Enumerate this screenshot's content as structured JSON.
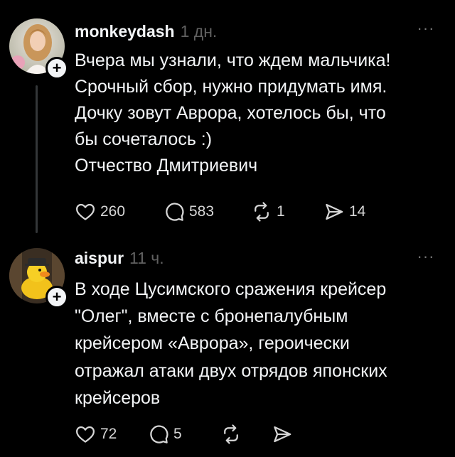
{
  "posts": [
    {
      "username": "monkeydash",
      "time": "1 дн.",
      "body_lines": [
        "Вчера мы узнали, что ждем мальчика!",
        "Срочный сбор, нужно придумать имя.",
        "Дочку зовут Аврора, хотелось бы, что",
        "бы сочеталось :)",
        "Отчество Дмитриевич"
      ],
      "likes": "260",
      "comments": "583",
      "reposts": "1",
      "shares": "14",
      "avatar_icon": "woman-portrait-avatar",
      "follow_icon": "plus-icon"
    },
    {
      "username": "aispur",
      "time": "11 ч.",
      "body_lines": [
        "В ходе Цусимского сражения крейсер",
        "\"Олег\", вместе с бронепалубным",
        "крейсером «Аврора», героически",
        "отражал атаки двух отрядов японских",
        "крейсеров"
      ],
      "likes": "72",
      "comments": "5",
      "reposts": "",
      "shares": "",
      "avatar_icon": "rubber-duck-avatar",
      "follow_icon": "plus-icon"
    }
  ],
  "colors": {
    "background": "#000000",
    "text": "#f3f5f7",
    "muted": "#616161",
    "thread_line": "#333638"
  }
}
